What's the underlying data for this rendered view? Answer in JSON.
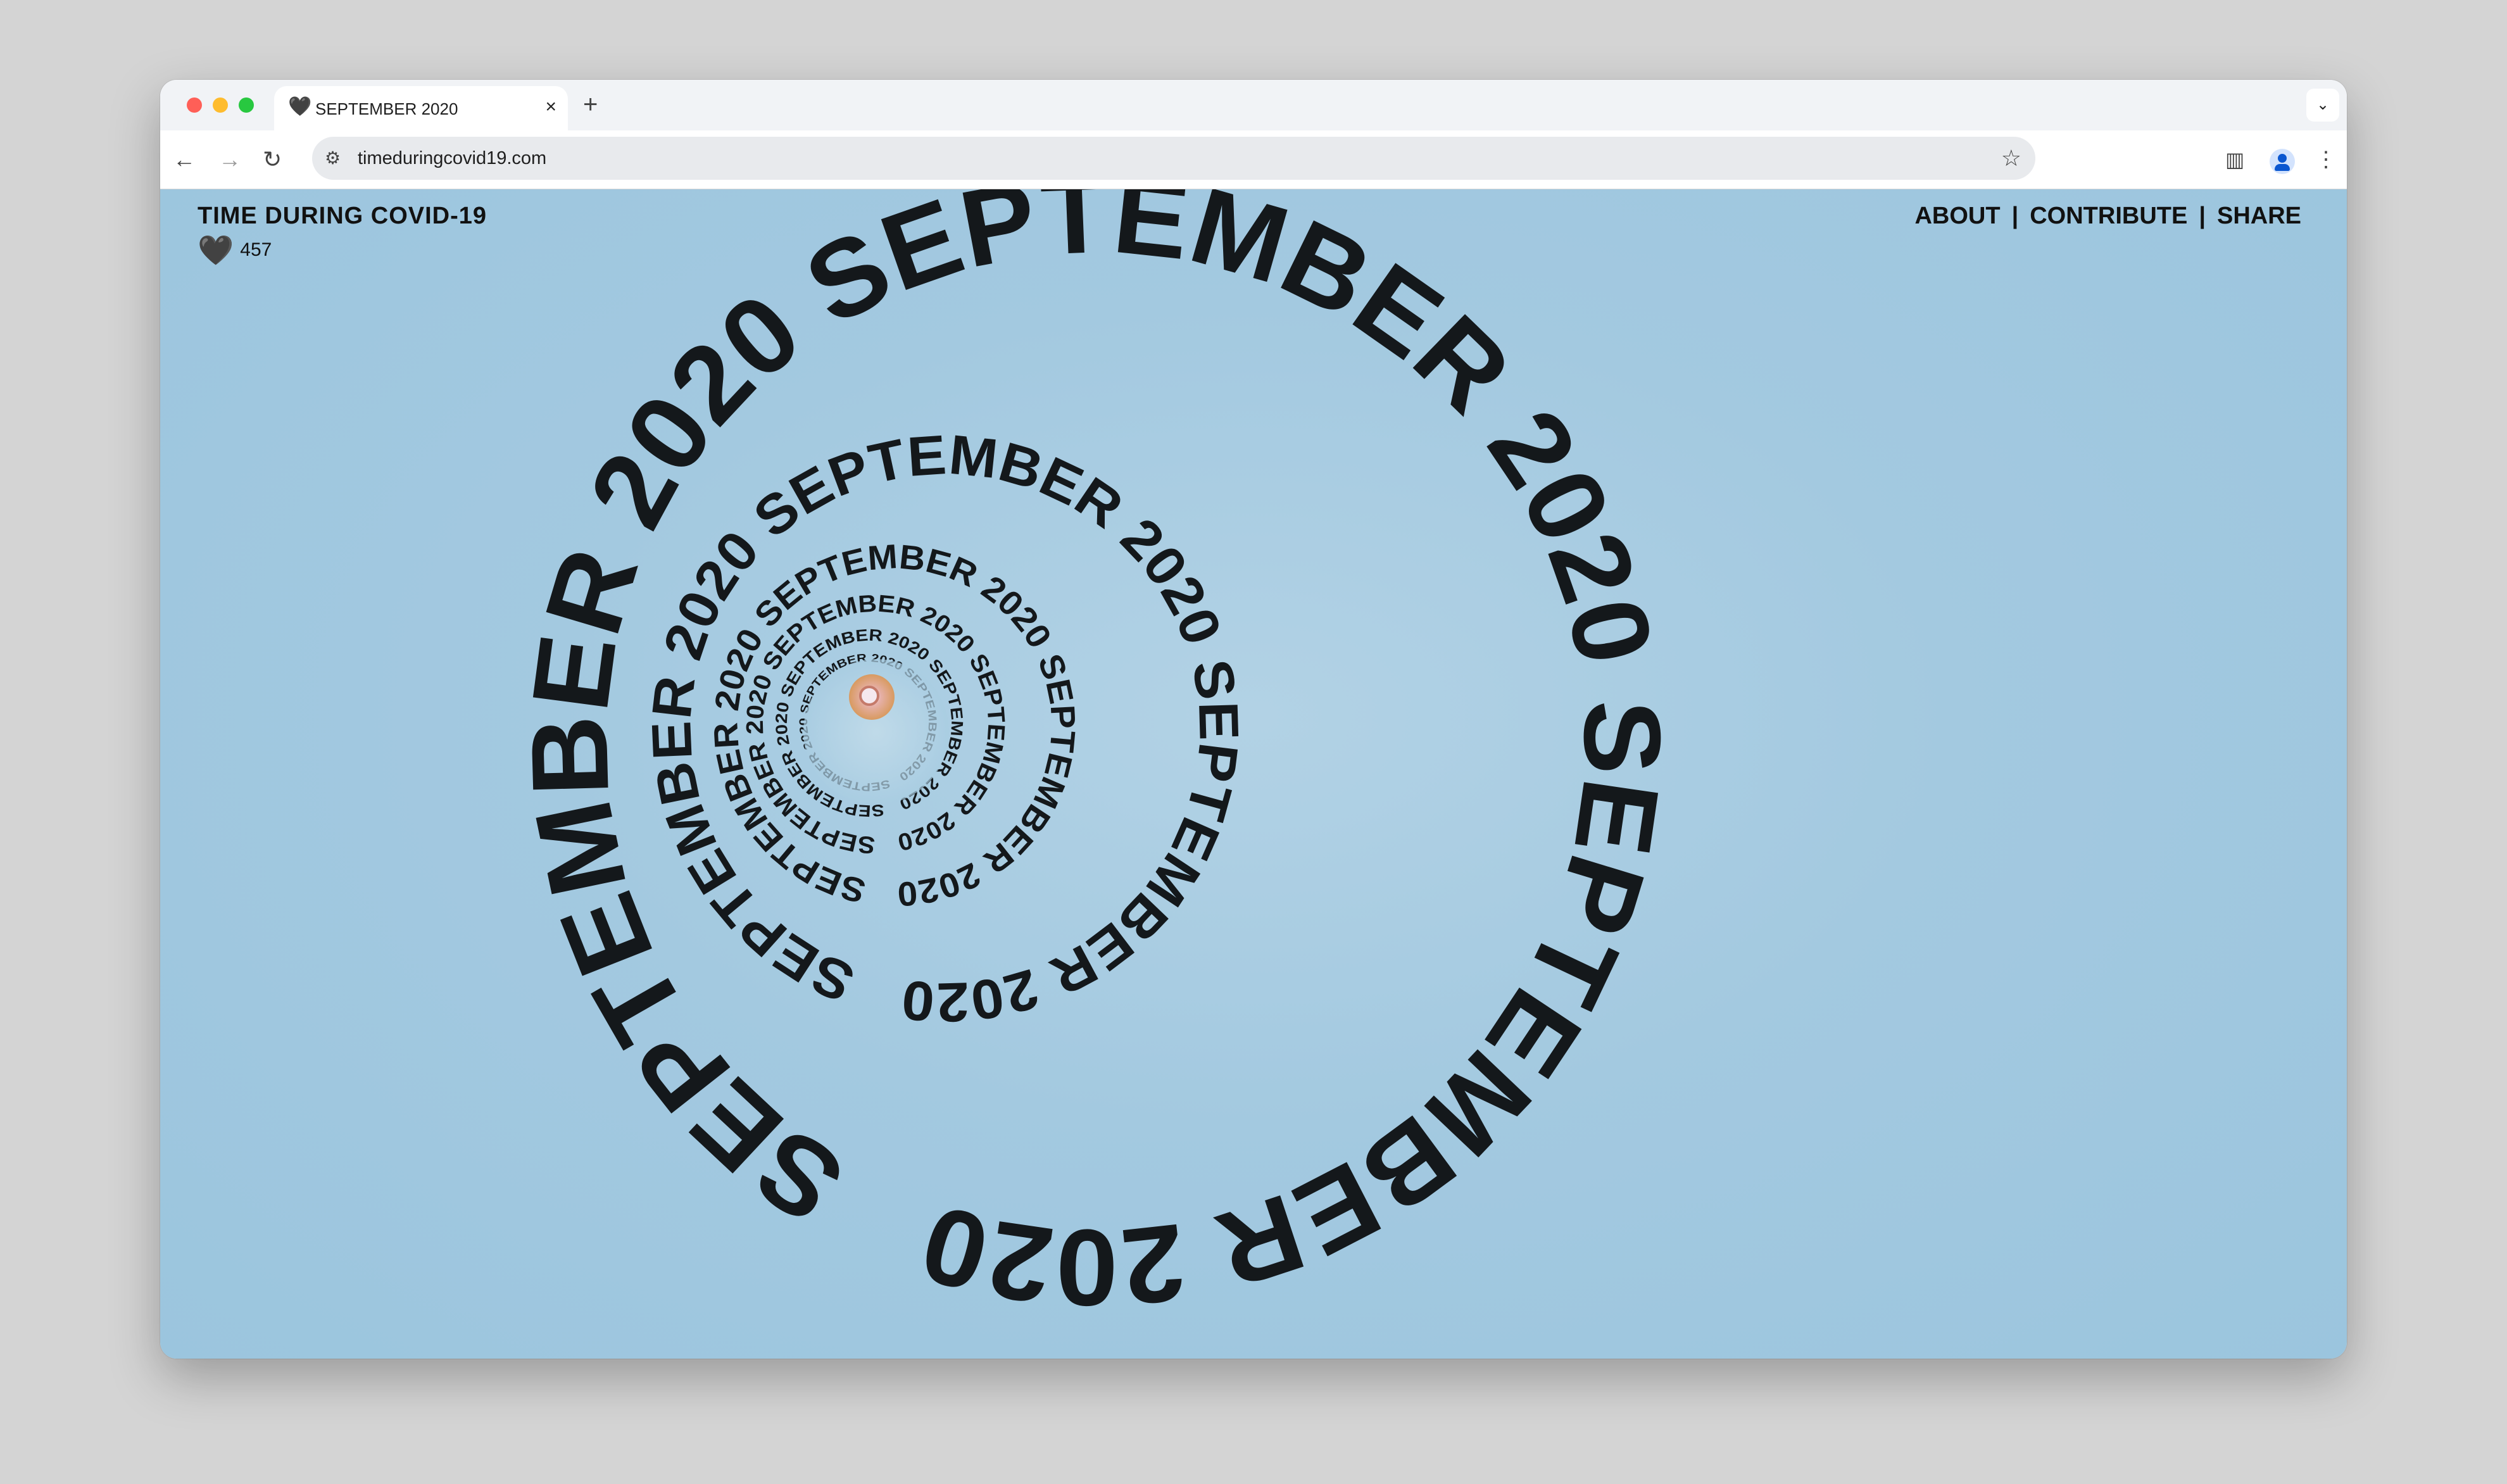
{
  "browser": {
    "tab_title": "SEPTEMBER 2020",
    "tab_icon": "black-heart",
    "new_tab_label": "+",
    "close_label": "×",
    "url": "timeduringcovid19.com"
  },
  "site": {
    "title": "TIME DURING COVID-19",
    "heart_glyph": "🖤",
    "heart_count": "457",
    "nav": {
      "about": "ABOUT",
      "separator": "|",
      "contribute": "CONTRIBUTE",
      "share": "SHARE"
    }
  },
  "spiral": {
    "ring_text": "SEPTEMBER 2020 SEPTEMBER 2020 SEPTEMBER 2020",
    "text_color": "#14181b",
    "background_color": "#a3c9e0"
  }
}
